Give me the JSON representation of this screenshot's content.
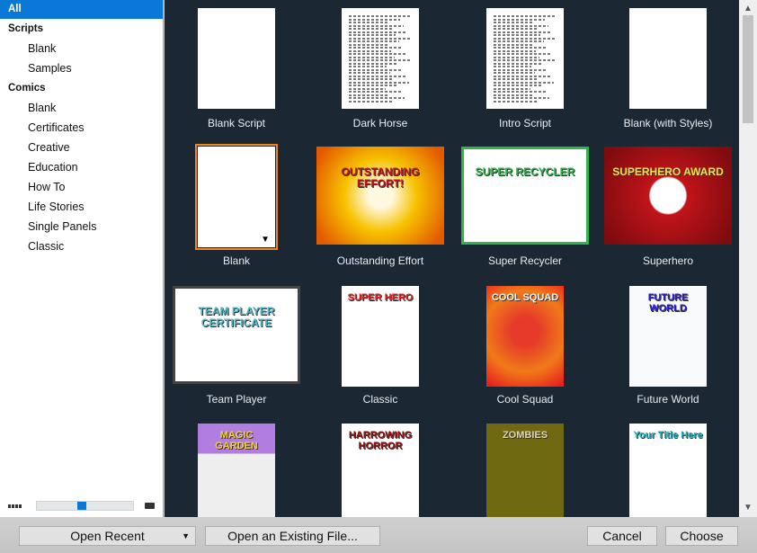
{
  "sidebar": {
    "items": [
      {
        "label": "All",
        "type": "cat",
        "selected": true
      },
      {
        "label": "Scripts",
        "type": "cat"
      },
      {
        "label": "Blank",
        "type": "sub"
      },
      {
        "label": "Samples",
        "type": "sub"
      },
      {
        "label": "Comics",
        "type": "cat"
      },
      {
        "label": "Blank",
        "type": "sub"
      },
      {
        "label": "Certificates",
        "type": "sub"
      },
      {
        "label": "Creative",
        "type": "sub"
      },
      {
        "label": "Education",
        "type": "sub"
      },
      {
        "label": "How To",
        "type": "sub"
      },
      {
        "label": "Life Stories",
        "type": "sub"
      },
      {
        "label": "Single Panels",
        "type": "sub"
      },
      {
        "label": "Classic",
        "type": "sub"
      }
    ],
    "zoom_level": 0.5
  },
  "templates": [
    {
      "label": "Blank Script",
      "orientation": "portrait",
      "bg": "#ffffff",
      "style": "blank"
    },
    {
      "label": "Dark Horse",
      "orientation": "portrait",
      "bg": "#ffffff",
      "style": "text"
    },
    {
      "label": "Intro Script",
      "orientation": "portrait",
      "bg": "#ffffff",
      "style": "text"
    },
    {
      "label": "Blank (with Styles)",
      "orientation": "portrait",
      "bg": "#ffffff",
      "style": "blank"
    },
    {
      "label": "Blank",
      "orientation": "portrait",
      "bg": "#ffffff",
      "style": "blank",
      "selected": true,
      "dropdown": "▼"
    },
    {
      "label": "Outstanding Effort",
      "orientation": "landscape",
      "bg": "radial-gradient(circle,#fff8e0 15%,#f7c200 45%,#e35a00 90%)",
      "style": "art",
      "art_text": "OUTSTANDING EFFORT!",
      "art_color": "#c1121f"
    },
    {
      "label": "Super Recycler",
      "orientation": "landscape",
      "bg": "#ffffff",
      "style": "art",
      "art_text": "SUPER RECYCLER",
      "art_color": "#2fb34a",
      "border": "#2fb34a"
    },
    {
      "label": "Superhero",
      "orientation": "landscape",
      "bg": "radial-gradient(circle,#fff 22%,#c0141a 24%,#7e0b0e 90%)",
      "style": "art",
      "art_text": "SUPERHERO AWARD",
      "art_color": "#ffe04a"
    },
    {
      "label": "Team Player",
      "orientation": "landscape",
      "bg": "#ffffff",
      "style": "art",
      "art_text": "TEAM PLAYER CERTIFICATE",
      "art_color": "#52b7c8",
      "border": "#444"
    },
    {
      "label": "Classic",
      "orientation": "portrait",
      "bg": "#ffffff",
      "style": "art",
      "art_text": "SUPER HERO",
      "art_color": "#e42424"
    },
    {
      "label": "Cool Squad",
      "orientation": "portrait",
      "bg": "radial-gradient(circle at 50% 45%,#e63a2a 20%,#f07a18 60%,#e82020 95%)",
      "style": "art",
      "art_text": "COOL SQUAD",
      "art_color": "#ffffff"
    },
    {
      "label": "Future World",
      "orientation": "portrait",
      "bg": "#f8f9fb",
      "style": "art",
      "art_text": "FUTURE WORLD",
      "art_color": "#2b1fc9"
    },
    {
      "label": "",
      "orientation": "portrait",
      "bg": "linear-gradient(#b07de0 0 30%,#eeeeee 30%)",
      "style": "art",
      "art_text": "MAGIC GARDEN",
      "art_color": "#f3d13a"
    },
    {
      "label": "",
      "orientation": "portrait",
      "bg": "#ffffff",
      "style": "art",
      "art_text": "HARROWING HORROR",
      "art_color": "#8c1010"
    },
    {
      "label": "",
      "orientation": "portrait",
      "bg": "#6f6a12",
      "style": "art",
      "art_text": "ZOMBIES",
      "art_color": "#e3d6a8"
    },
    {
      "label": "",
      "orientation": "portrait",
      "bg": "#ffffff",
      "style": "art",
      "art_text": "Your Title Here",
      "art_color": "#1fb8c4"
    }
  ],
  "footer": {
    "open_recent": "Open Recent",
    "open_recent_arrow": "▼",
    "open_existing": "Open an Existing File...",
    "cancel": "Cancel",
    "choose": "Choose"
  },
  "scrollbar": {
    "up": "▲",
    "down": "▼"
  }
}
